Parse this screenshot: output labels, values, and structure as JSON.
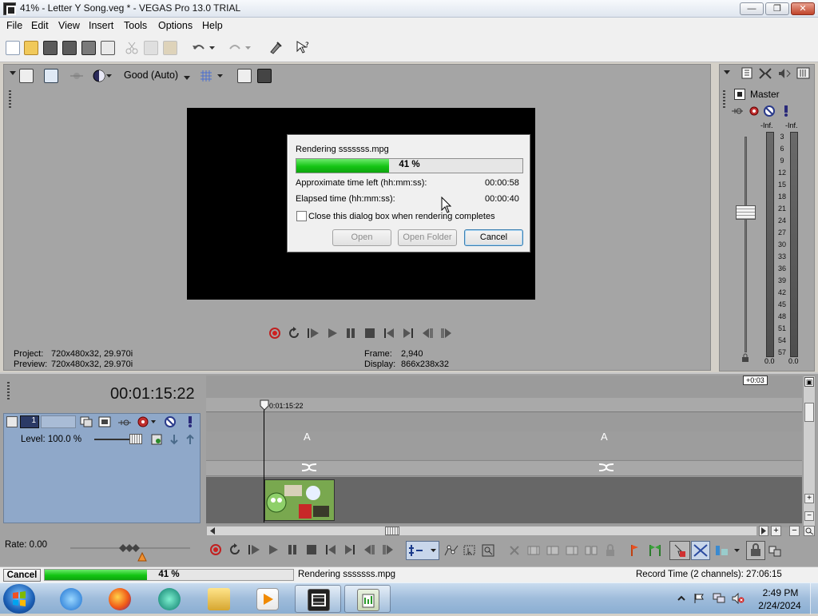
{
  "window": {
    "title": "41% - Letter Y Song.veg * - VEGAS Pro 13.0 TRIAL"
  },
  "menu": [
    "File",
    "Edit",
    "View",
    "Insert",
    "Tools",
    "Options",
    "Help"
  ],
  "preview": {
    "quality": "Good (Auto)",
    "project_label": "Project:",
    "project_value": "720x480x32, 29.970i",
    "preview_label": "Preview:",
    "preview_value": "720x480x32, 29.970i",
    "frame_label": "Frame:",
    "frame_value": "2,940",
    "display_label": "Display:",
    "display_value": "866x238x32"
  },
  "render_dialog": {
    "title": "Rendering sssssss.mpg",
    "progress_percent": 41,
    "progress_label": "41 %",
    "time_left_label": "Approximate time left (hh:mm:ss):",
    "time_left_value": "00:00:58",
    "elapsed_label": "Elapsed time (hh:mm:ss):",
    "elapsed_value": "00:00:40",
    "close_checkbox_label": "Close this dialog box when rendering completes",
    "close_checkbox_checked": false,
    "open_button": "Open",
    "open_folder_button": "Open Folder",
    "cancel_button": "Cancel"
  },
  "master": {
    "label": "Master",
    "peak_left": "-Inf.",
    "peak_right": "-Inf.",
    "scale": [
      "3",
      "6",
      "9",
      "12",
      "15",
      "18",
      "21",
      "24",
      "27",
      "30",
      "33",
      "36",
      "39",
      "42",
      "45",
      "48",
      "51",
      "54",
      "57"
    ],
    "bottom_left": "0.0",
    "bottom_right": "0.0",
    "offset_badge": "+0:03"
  },
  "timeline": {
    "timecode": "00:01:15:22",
    "cursor_time": "0:01:15:22",
    "track_number": "1",
    "level_label": "Level: 100.0 %",
    "transition_marker": "A",
    "rate_label": "Rate: 0.00"
  },
  "statusbar": {
    "cancel": "Cancel",
    "progress_percent": 41,
    "progress_label": "41 %",
    "message": "Rendering sssssss.mpg",
    "record_time": "Record Time (2 channels): 27:06:15"
  },
  "taskbar": {
    "time": "2:49 PM",
    "date": "2/24/2024"
  },
  "colors": {
    "progress_green": "#14c414",
    "track_header_blue": "#8fa8c9",
    "record_red": "#d02020"
  }
}
